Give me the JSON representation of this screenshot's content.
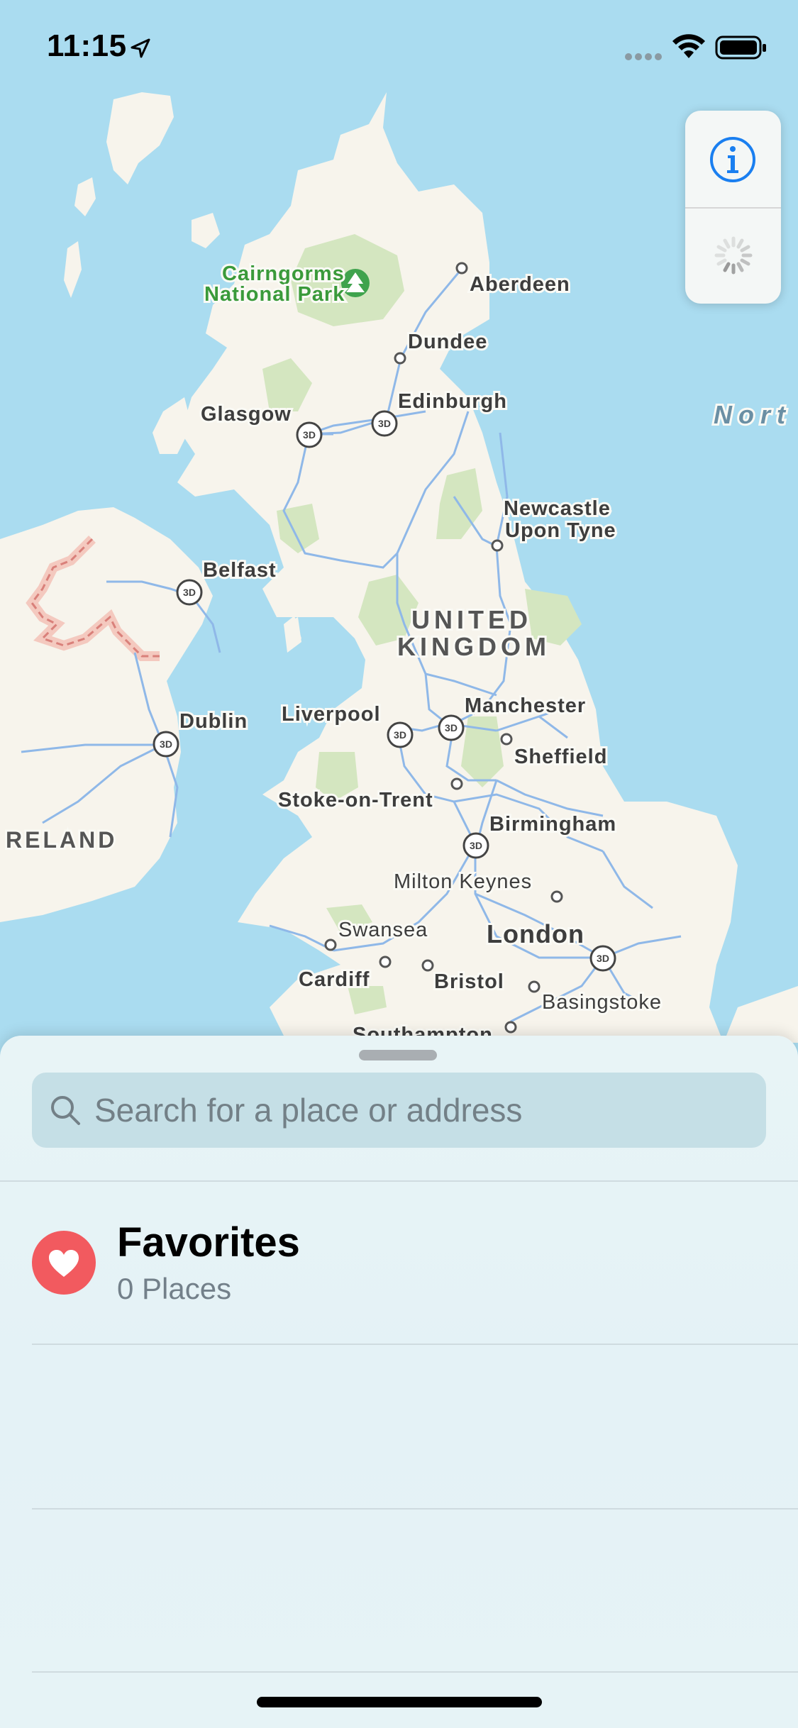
{
  "status_bar": {
    "time": "11:15"
  },
  "map": {
    "labels": {
      "aberdeen": "Aberdeen",
      "cairngorms_1": "Cairngorms",
      "cairngorms_2": "National Park",
      "dundee": "Dundee",
      "edinburgh": "Edinburgh",
      "glasgow": "Glasgow",
      "north_sea": "Nort",
      "newcastle_1": "Newcastle",
      "newcastle_2": "Upon Tyne",
      "belfast": "Belfast",
      "uk_1": "UNITED",
      "uk_2": "KINGDOM",
      "manchester": "Manchester",
      "liverpool": "Liverpool",
      "dublin": "Dublin",
      "sheffield": "Sheffield",
      "stoke": "Stoke-on-Trent",
      "birmingham": "Birmingham",
      "ireland": "RELAND",
      "milton_keynes": "Milton Keynes",
      "swansea": "Swansea",
      "london": "London",
      "cardiff": "Cardiff",
      "bristol": "Bristol",
      "basingstoke": "Basingstoke",
      "southampton": "Southampton"
    },
    "badge_3d": "3D",
    "colors": {
      "water": "#aadcf0",
      "land": "#f7f4ec",
      "park": "#d4e6c0",
      "park_text": "#3a9a3a",
      "road": "#8fb8e8",
      "border": "#e8a9a0"
    }
  },
  "map_controls": {
    "info_icon": "info-icon",
    "location_icon": "activity-spinner-icon",
    "accent": "#1a7ff0"
  },
  "sheet": {
    "search": {
      "placeholder": "Search for a place or address",
      "icon": "search-icon"
    },
    "favorites": {
      "title": "Favorites",
      "subtitle": "0 Places",
      "color": "#f25a5f",
      "icon": "heart-icon"
    }
  }
}
